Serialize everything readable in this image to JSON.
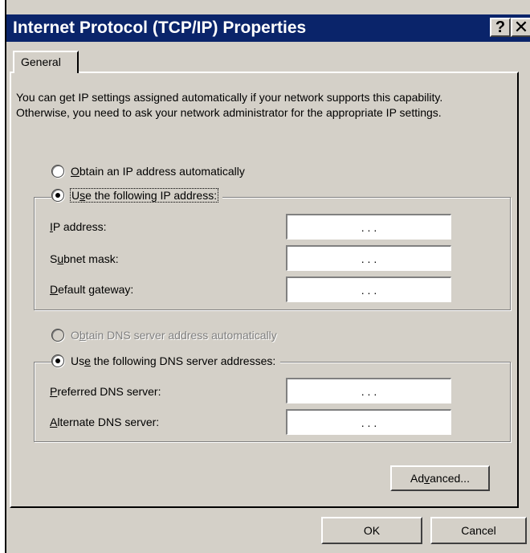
{
  "window": {
    "title": "Internet Protocol (TCP/IP) Properties",
    "help_glyph": "?",
    "close_glyph": "✕"
  },
  "tabs": [
    {
      "label": "General",
      "selected": true
    }
  ],
  "description": "You can get IP settings assigned automatically if your network supports this capability. Otherwise, you need to ask your network administrator for the appropriate IP settings.",
  "ip_mode": {
    "auto": {
      "label_u": "O",
      "label_rest": "btain an IP address automatically",
      "selected": false
    },
    "manual": {
      "label_pre": "",
      "label_u": "s",
      "label_pre2": "U",
      "label_rest": "e the following IP address:",
      "selected": true
    }
  },
  "ip_fields": [
    {
      "label_u": "I",
      "label_rest": "P address:",
      "value": ".     .     ."
    },
    {
      "label_pre": "S",
      "label_u": "u",
      "label_rest": "bnet mask:",
      "value": ".     .     ."
    },
    {
      "label_u": "D",
      "label_rest": "efault gateway:",
      "value": ".     .     ."
    }
  ],
  "dns_mode": {
    "auto": {
      "label_pre": "O",
      "label_u": "b",
      "label_rest": "tain DNS server address automatically",
      "selected": false,
      "disabled": true
    },
    "manual": {
      "label_pre": "Us",
      "label_u": "e",
      "label_rest": " the following DNS server addresses:",
      "selected": true
    }
  },
  "dns_fields": [
    {
      "label_u": "P",
      "label_rest": "referred DNS server:",
      "value": ".     .     ."
    },
    {
      "label_u": "A",
      "label_rest": "lternate DNS server:",
      "value": ".     .     ."
    }
  ],
  "buttons": {
    "advanced": {
      "pre": "Ad",
      "u": "v",
      "rest": "anced..."
    },
    "ok": "OK",
    "cancel": "Cancel"
  }
}
